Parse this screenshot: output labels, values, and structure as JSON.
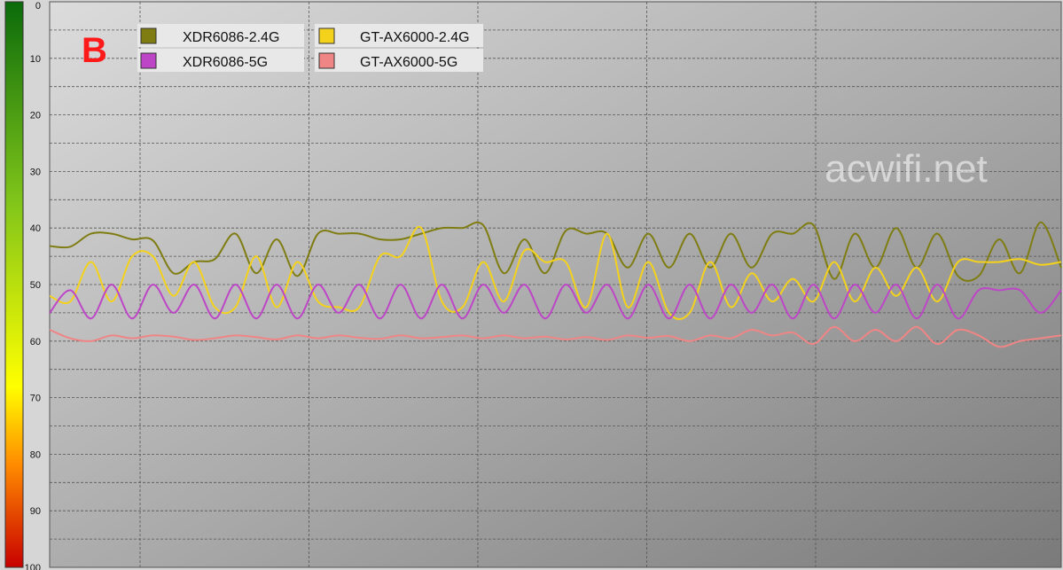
{
  "chart_data": {
    "type": "line",
    "panel_label": "B",
    "watermark": "acwifi.net",
    "y_axis": {
      "ticks": [
        "0",
        "10",
        "20",
        "30",
        "40",
        "50",
        "60",
        "70",
        "80",
        "90",
        "100"
      ],
      "tick_values": [
        0,
        10,
        20,
        30,
        40,
        50,
        60,
        70,
        80,
        90,
        100
      ],
      "ylim": [
        0,
        100
      ],
      "inverted": true,
      "gradient_colors": [
        "#0b6b0b",
        "#7fc41a",
        "#ffff00",
        "#ff8a00",
        "#c80000"
      ]
    },
    "grid": true,
    "legend_position": "top-left",
    "series": [
      {
        "name": "XDR6086-2.4G",
        "color": "#7f7d12",
        "values": [
          43.2,
          43.3,
          41.0,
          41.0,
          42.0,
          42.2,
          48.0,
          46.0,
          45.5,
          41.0,
          48.0,
          42.0,
          48.5,
          41.0,
          41.0,
          41.0,
          42.0,
          42.0,
          41.0,
          40.0,
          40.0,
          39.5,
          48.0,
          42.0,
          48.0,
          40.5,
          41.0,
          41.0,
          47.0,
          41.0,
          47.0,
          41.0,
          47.0,
          41.0,
          47.0,
          41.0,
          41.0,
          39.5,
          49.0,
          41.0,
          47.0,
          40.0,
          47.0,
          41.0,
          48.5,
          48.5,
          42.0,
          48.0,
          39.0,
          47.0
        ]
      },
      {
        "name": "GT-AX6000-2.4G",
        "color": "#f4d21c",
        "values": [
          52.0,
          53.0,
          46.0,
          53.0,
          45.0,
          45.0,
          52.0,
          46.0,
          54.0,
          54.0,
          45.0,
          54.0,
          46.0,
          53.0,
          54.0,
          54.0,
          45.0,
          45.0,
          40.0,
          53.0,
          54.0,
          46.0,
          53.0,
          44.0,
          46.0,
          46.0,
          54.0,
          41.0,
          54.0,
          46.0,
          55.0,
          55.0,
          46.0,
          54.0,
          48.0,
          53.0,
          49.0,
          53.0,
          46.0,
          53.0,
          47.0,
          52.0,
          47.0,
          53.0,
          46.0,
          46.0,
          46.0,
          45.5,
          46.5,
          46.0
        ]
      },
      {
        "name": "XDR6086-5G",
        "color": "#bd46c7",
        "values": [
          55.0,
          51.0,
          56.0,
          50.0,
          56.0,
          50.0,
          55.0,
          50.0,
          56.0,
          50.0,
          56.0,
          50.0,
          56.0,
          50.0,
          55.0,
          50.0,
          56.0,
          50.0,
          56.0,
          50.0,
          56.0,
          50.0,
          55.0,
          50.0,
          56.0,
          50.0,
          55.0,
          50.0,
          56.0,
          50.0,
          56.0,
          50.0,
          56.0,
          50.0,
          55.0,
          50.0,
          56.0,
          50.0,
          56.0,
          50.0,
          55.0,
          50.0,
          56.0,
          50.0,
          56.0,
          51.0,
          51.0,
          51.0,
          55.0,
          51.0
        ]
      },
      {
        "name": "GT-AX6000-5G",
        "color": "#f08585",
        "values": [
          58.0,
          59.5,
          60.0,
          59.0,
          59.5,
          59.0,
          59.2,
          59.8,
          59.5,
          59.0,
          59.3,
          59.7,
          59.0,
          59.5,
          59.0,
          59.4,
          59.6,
          59.0,
          59.5,
          59.3,
          59.0,
          59.5,
          59.0,
          59.5,
          59.2,
          59.7,
          59.3,
          59.8,
          59.0,
          59.4,
          59.1,
          60.0,
          59.0,
          59.5,
          58.0,
          59.0,
          58.5,
          60.5,
          57.5,
          60.0,
          58.0,
          60.0,
          57.5,
          60.5,
          58.0,
          59.0,
          61.0,
          60.0,
          59.5,
          59.0
        ]
      }
    ]
  }
}
